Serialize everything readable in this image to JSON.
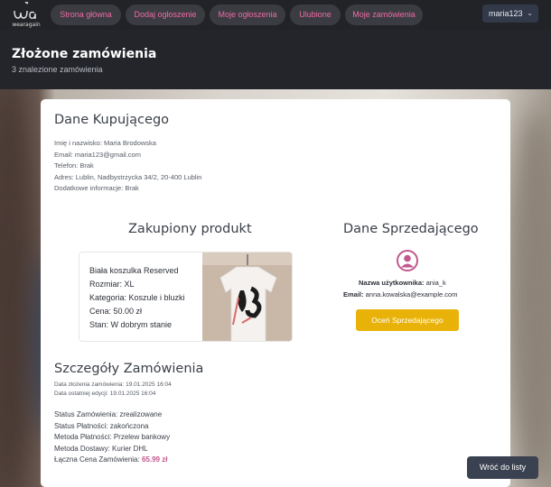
{
  "nav": {
    "logo_text": "wearagain",
    "items": [
      "Strona główna",
      "Dodaj ogłoszenie",
      "Moje ogłoszenia",
      "Ulubione",
      "Moje zamówienia"
    ],
    "user": "maria123"
  },
  "header": {
    "title": "Złożone zamówienia",
    "subtitle": "3 znalezione zamówienia"
  },
  "buyer": {
    "heading": "Dane Kupującego",
    "name": "Imię i nazwisko: Maria Brodowska",
    "email": "Email: maria123@gmail.com",
    "phone": "Telefon: Brak",
    "address": "Adres: Lublin, Nadbystrzycka 34/2, 20-400 Lublin",
    "extra": "Dodatkowe informacje: Brak"
  },
  "product": {
    "heading": "Zakupiony produkt",
    "name": "Biała koszulka Reserved",
    "size": "Rozmiar: XL",
    "category": "Kategoria: Koszule i bluzki",
    "price": "Cena: 50.00 zł",
    "condition": "Stan: W dobrym stanie"
  },
  "seller": {
    "heading": "Dane Sprzedającego",
    "username_label": "Nazwa użytkownika:",
    "username": "ania_k",
    "email_label": "Email:",
    "email": "anna.kowalska@example.com",
    "rate_button": "Oceń Sprzedającego"
  },
  "order": {
    "heading": "Szczegóły Zamówienia",
    "created": "Data złożenia zamówienia: 19.01.2025 16:04",
    "edited": "Data ostatniej edycji: 19.01.2025 16:04",
    "status": "Status Zamówienia: zrealizowane",
    "payment_status": "Status Płatności: zakończona",
    "payment_method": "Metoda Płatności: Przelew bankowy",
    "delivery_method": "Metoda Dostawy: Kurier DHL",
    "total_label": "Łączna Cena Zamówienia:",
    "total": "65.99 zł"
  },
  "back_button": "Wróć do listy",
  "colors": {
    "accent_pink": "#f06aa6",
    "rate_yellow": "#e9b208",
    "price_pink": "#c2588e",
    "avatar_pink": "#c2588e"
  }
}
